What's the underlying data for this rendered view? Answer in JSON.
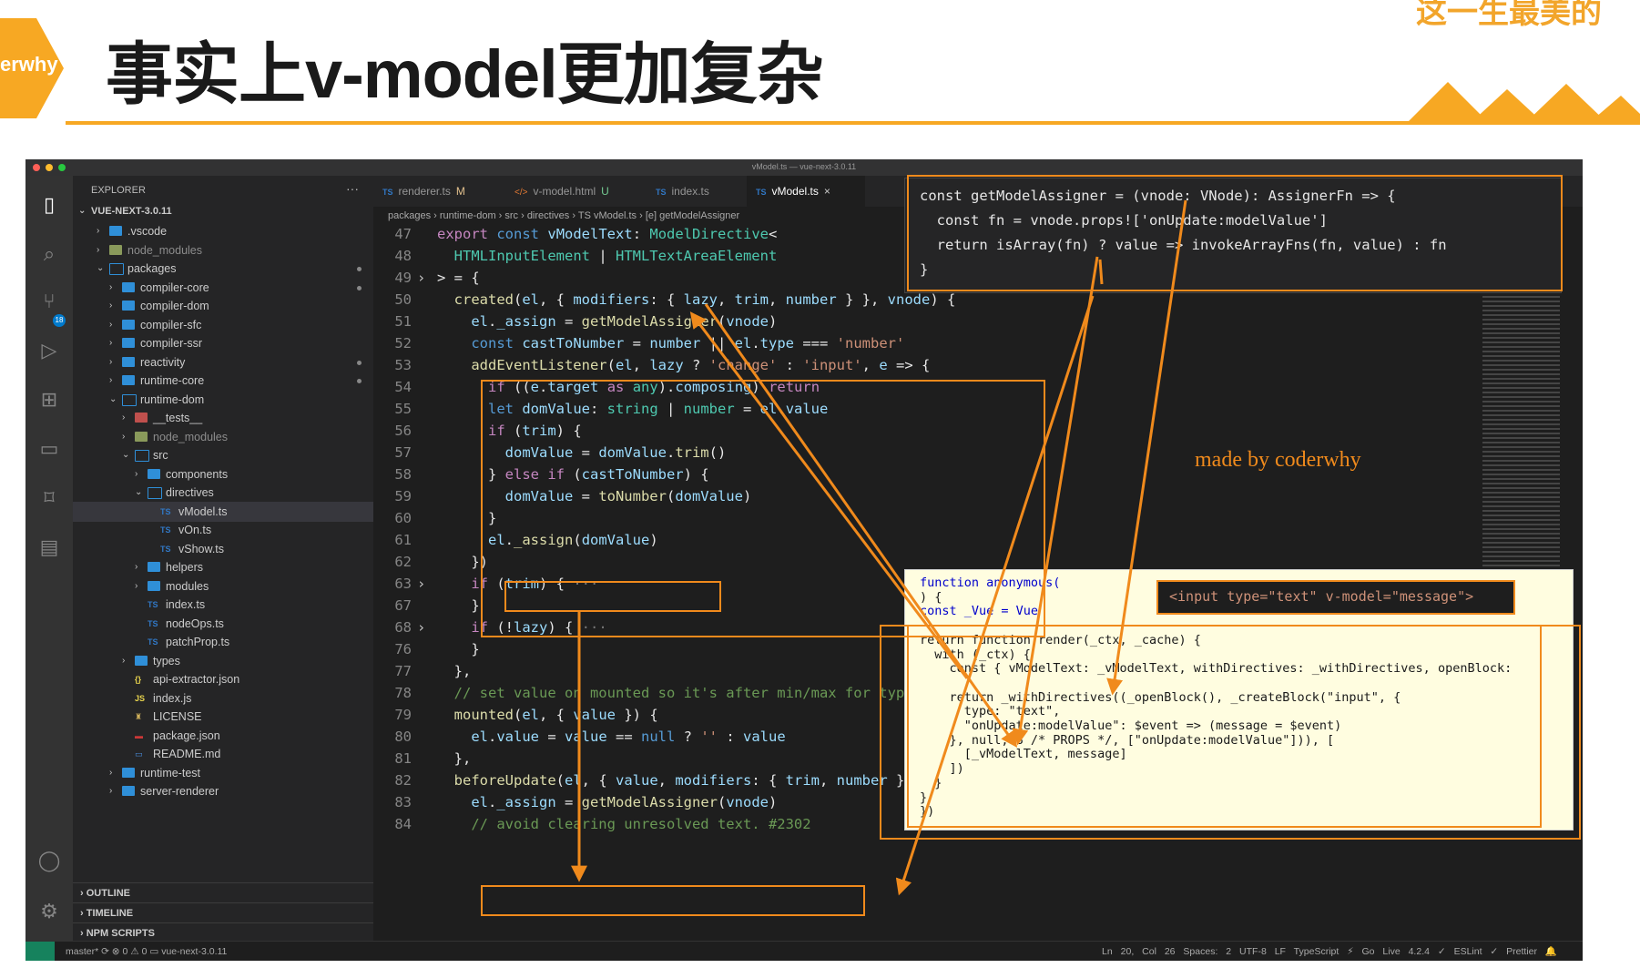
{
  "slide": {
    "title": "事实上v-model更加复杂",
    "logo_text": "erwhy",
    "corner_text": "这一生最美的",
    "watermark": "made by coderwhy",
    "accent": "#f7a823"
  },
  "window": {
    "title": "vModel.ts — vue-next-3.0.11"
  },
  "activity_bar": {
    "scm_badge": "18"
  },
  "explorer": {
    "title": "EXPLORER",
    "more": "···",
    "root": "VUE-NEXT-3.0.11",
    "items": [
      {
        "label": ".vscode",
        "depth": 1,
        "kind": "folder",
        "state": "collapsed"
      },
      {
        "label": "node_modules",
        "depth": 1,
        "kind": "folder-gray",
        "state": "collapsed"
      },
      {
        "label": "packages",
        "depth": 1,
        "kind": "folder-open",
        "state": "expanded",
        "dot": true
      },
      {
        "label": "compiler-core",
        "depth": 2,
        "kind": "folder",
        "state": "collapsed",
        "dot": true
      },
      {
        "label": "compiler-dom",
        "depth": 2,
        "kind": "folder",
        "state": "collapsed"
      },
      {
        "label": "compiler-sfc",
        "depth": 2,
        "kind": "folder",
        "state": "collapsed"
      },
      {
        "label": "compiler-ssr",
        "depth": 2,
        "kind": "folder",
        "state": "collapsed"
      },
      {
        "label": "reactivity",
        "depth": 2,
        "kind": "folder",
        "state": "collapsed",
        "dot": true
      },
      {
        "label": "runtime-core",
        "depth": 2,
        "kind": "folder",
        "state": "collapsed",
        "dot": true
      },
      {
        "label": "runtime-dom",
        "depth": 2,
        "kind": "folder-open",
        "state": "expanded"
      },
      {
        "label": "__tests__",
        "depth": 3,
        "kind": "folder-test",
        "state": "collapsed"
      },
      {
        "label": "node_modules",
        "depth": 3,
        "kind": "folder-gray",
        "state": "collapsed"
      },
      {
        "label": "src",
        "depth": 3,
        "kind": "folder-open",
        "state": "expanded"
      },
      {
        "label": "components",
        "depth": 4,
        "kind": "folder",
        "state": "collapsed"
      },
      {
        "label": "directives",
        "depth": 4,
        "kind": "folder-open",
        "state": "expanded"
      },
      {
        "label": "vModel.ts",
        "depth": 5,
        "kind": "ts",
        "selected": true
      },
      {
        "label": "vOn.ts",
        "depth": 5,
        "kind": "ts"
      },
      {
        "label": "vShow.ts",
        "depth": 5,
        "kind": "ts"
      },
      {
        "label": "helpers",
        "depth": 4,
        "kind": "folder",
        "state": "collapsed"
      },
      {
        "label": "modules",
        "depth": 4,
        "kind": "folder",
        "state": "collapsed"
      },
      {
        "label": "index.ts",
        "depth": 4,
        "kind": "ts"
      },
      {
        "label": "nodeOps.ts",
        "depth": 4,
        "kind": "ts"
      },
      {
        "label": "patchProp.ts",
        "depth": 4,
        "kind": "ts"
      },
      {
        "label": "types",
        "depth": 3,
        "kind": "folder",
        "state": "collapsed"
      },
      {
        "label": "api-extractor.json",
        "depth": 3,
        "kind": "json"
      },
      {
        "label": "index.js",
        "depth": 3,
        "kind": "js"
      },
      {
        "label": "LICENSE",
        "depth": 3,
        "kind": "license"
      },
      {
        "label": "package.json",
        "depth": 3,
        "kind": "npm"
      },
      {
        "label": "README.md",
        "depth": 3,
        "kind": "md"
      },
      {
        "label": "runtime-test",
        "depth": 2,
        "kind": "folder",
        "state": "collapsed"
      },
      {
        "label": "server-renderer",
        "depth": 2,
        "kind": "folder",
        "state": "collapsed"
      }
    ],
    "sections": [
      "OUTLINE",
      "TIMELINE",
      "NPM SCRIPTS"
    ]
  },
  "tabs": [
    {
      "icon": "TS",
      "label": "renderer.ts",
      "status": "M"
    },
    {
      "icon": "</>",
      "label": "v-model.html",
      "status": "U"
    },
    {
      "icon": "TS",
      "label": "index.ts",
      "status": ""
    },
    {
      "icon": "TS",
      "label": "vModel.ts",
      "status": "×",
      "active": true
    }
  ],
  "breadcrumb": "packages › runtime-dom › src › directives › TS vModel.ts › [e] getModelAssigner",
  "code_lines": [
    "47",
    "48",
    "49",
    "50",
    "51",
    "52",
    "53",
    "54",
    "55",
    "56",
    "57",
    "58",
    "59",
    "60",
    "61",
    "62",
    "63",
    "67",
    "68",
    "76",
    "77",
    "78",
    "79",
    "80",
    "81",
    "82",
    "83",
    "84"
  ],
  "hover_lines": [
    "const getModelAssigner = (vnode: VNode): AssignerFn => {",
    "  const fn = vnode.props!['onUpdate:modelValue']",
    "  return isArray(fn) ? value => invokeArrayFns(fn, value) : fn",
    "}"
  ],
  "compiled": {
    "template": "<input type=\"text\" v-model=\"message\">",
    "lines": [
      "function anonymous(",
      ") {",
      "const _Vue = Vue",
      "",
      "return function render(_ctx, _cache) {",
      "  with (_ctx) {",
      "    const { vModelText: _vModelText, withDirectives: _withDirectives, openBlock:",
      "",
      "    return _withDirectives((_openBlock(), _createBlock(\"input\", {",
      "      type: \"text\",",
      "      \"onUpdate:modelValue\": $event => (message = $event)",
      "    }, null, 8 /* PROPS */, [\"onUpdate:modelValue\"])), [",
      "      [_vModelText, message]",
      "    ])",
      "  }",
      "}",
      "})"
    ]
  },
  "status_bar": {
    "left": "master*   ⟳   ⊗ 0 ⚠ 0   ▭ vue-next-3.0.11",
    "right": "Ln 20, Col 26   Spaces: 2   UTF-8   LF   TypeScript   ⚡ Go Live   4.2.4   ✓ ESLint   ✓ Prettier   🔔"
  }
}
